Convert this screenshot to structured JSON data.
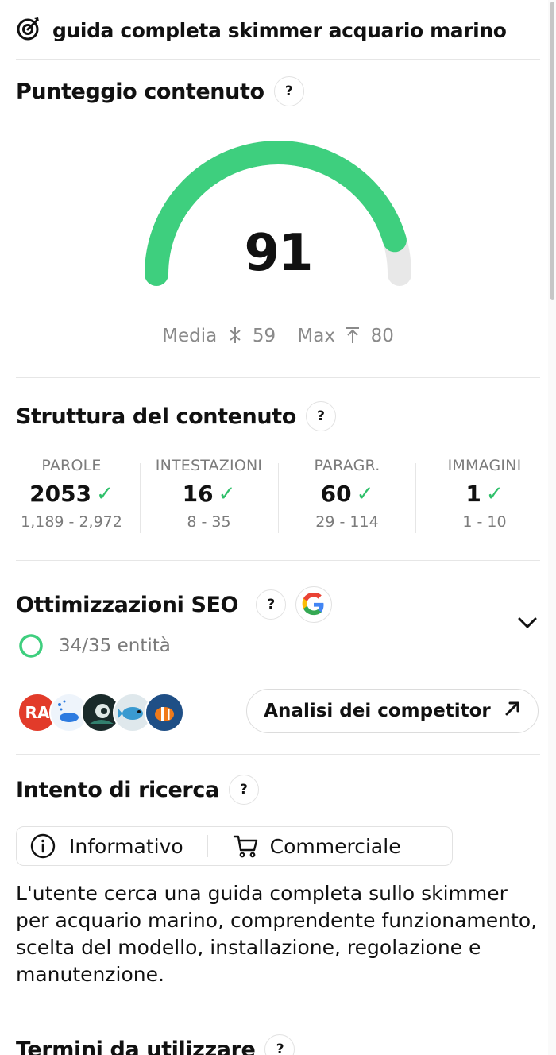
{
  "header": {
    "title": "guida completa skimmer acquario marino",
    "icon": "target-icon"
  },
  "score_section": {
    "title": "Punteggio contenuto",
    "help": "?",
    "score": "91",
    "score_fraction": 0.91,
    "colors": {
      "arc": "#3ecf7e",
      "track": "#e8e8e8"
    },
    "avg_label": "Media",
    "avg_value": "59",
    "max_label": "Max",
    "max_value": "80"
  },
  "structure": {
    "title": "Struttura del contenuto",
    "help": "?",
    "metrics": [
      {
        "label": "PAROLE",
        "value": "2053",
        "check": "✓",
        "range": "1,189 - 2,972"
      },
      {
        "label": "INTESTAZIONI",
        "value": "16",
        "check": "✓",
        "range": "8 - 35"
      },
      {
        "label": "PARAGR.",
        "value": "60",
        "check": "✓",
        "range": "29 - 114"
      },
      {
        "label": "IMMAGINI",
        "value": "1",
        "check": "✓",
        "range": "1 - 10"
      }
    ]
  },
  "seo": {
    "title": "Ottimizzazioni SEO",
    "help": "?",
    "entities": "34/35 entità",
    "entities_fraction": 0.971,
    "competitor_button": "Analisi dei competitor",
    "avatar_badge": "RA"
  },
  "intent": {
    "title": "Intento di ricerca",
    "help": "?",
    "items": [
      "Informativo",
      "Commerciale"
    ],
    "description": "L'utente cerca una guida completa sullo skimmer per acquario marino, comprendente funzionamento, scelta del modello, installazione, regolazione e manutenzione."
  },
  "terms": {
    "title": "Termini da utilizzare",
    "help": "?"
  }
}
